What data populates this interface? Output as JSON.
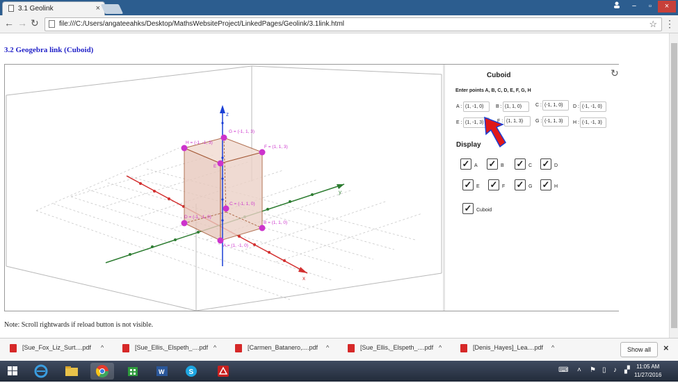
{
  "browser": {
    "tab_title": "3.1 Geolink",
    "tab_close": "×",
    "url": "file:///C:/Users/angateeahks/Desktop/MathsWebsiteProject/LinkedPages/Geolink/3.1link.html",
    "back": "←",
    "forward": "→",
    "reload": "↻",
    "star": "☆",
    "menu": "⋮",
    "window_buttons": [
      "−",
      "▫",
      "×"
    ]
  },
  "page": {
    "heading": "3.2    Geogebra link (Cuboid)",
    "note": "Note: Scroll rightwards if reload button is not visible."
  },
  "geogebra": {
    "panel_title": "Cuboid",
    "refresh": "↻",
    "enter_label": "Enter points A, B, C, D, E, F, G, H",
    "points": [
      {
        "label": "A :",
        "value": "(1, -1, 0)"
      },
      {
        "label": "B :",
        "value": "(1, 1, 0)"
      },
      {
        "label": "C :",
        "value": "(-1, 1, 0)"
      },
      {
        "label": "D :",
        "value": "(-1, -1, 0)"
      },
      {
        "label": "E :",
        "value": "(1, -1, 3)"
      },
      {
        "label": "F :",
        "value": "(1, 1, 3)"
      },
      {
        "label": "G :",
        "value": "(-1, 1, 3)"
      },
      {
        "label": "H :",
        "value": "(-1, -1, 3)"
      }
    ],
    "display_label": "Display",
    "checkboxes": [
      {
        "label": "A",
        "checked": true
      },
      {
        "label": "B",
        "checked": true
      },
      {
        "label": "C",
        "checked": true
      },
      {
        "label": "D",
        "checked": true
      },
      {
        "label": "E",
        "checked": true
      },
      {
        "label": "F",
        "checked": true
      },
      {
        "label": "G",
        "checked": true
      },
      {
        "label": "H",
        "checked": true
      },
      {
        "label": "Cuboid",
        "checked": true
      }
    ],
    "check_glyph": "✓",
    "axes": {
      "x": "x",
      "y": "y",
      "z": "z"
    },
    "point_labels": {
      "A": "A = (1, -1, 0)",
      "B": "B = (1, 1, 0)",
      "C": "C = (-1, 1, 0)",
      "D": "D = (-1, -1, 0)",
      "E": "E",
      "F": "F = (1, 1, 3)",
      "G": "G = (-1, 1, 3)",
      "H": "H = (-1, -1, 3)"
    },
    "colors": {
      "cuboid_fill": "#e8c9bd",
      "cuboid_edge": "#a0522d",
      "point": "#cc33cc",
      "x_axis": "#d32f2f",
      "y_axis": "#2e7d32",
      "z_axis": "#1a3fd6",
      "arrow": "#e01818"
    }
  },
  "downloads": {
    "items": [
      {
        "name": "[Sue_Fox_Liz_Surt....pdf"
      },
      {
        "name": "[Sue_Ellis,_Elspeth_....pdf"
      },
      {
        "name": "[Carmen_Batanero,....pdf"
      },
      {
        "name": "[Sue_Ellis,_Elspeth_....pdf"
      },
      {
        "name": "[Denis_Hayes]_Lea....pdf"
      }
    ],
    "caret": "^",
    "show_all": "Show all",
    "close": "×"
  },
  "taskbar": {
    "time": "11:05 AM",
    "date": "11/27/2016"
  }
}
